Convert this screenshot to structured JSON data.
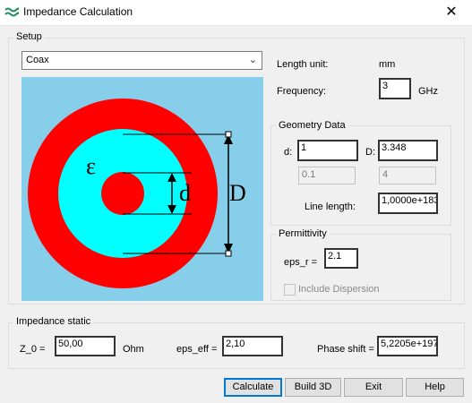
{
  "window": {
    "title": "Impedance Calculation",
    "close_glyph": "✕"
  },
  "setup": {
    "group_label": "Setup",
    "line_type": "Coax",
    "length_unit_label": "Length unit:",
    "length_unit_value": "mm",
    "frequency_label": "Frequency:",
    "frequency_value": "3",
    "frequency_unit": "GHz"
  },
  "diagram": {
    "epsilon_symbol": "ε",
    "inner_label": "d",
    "outer_label": "D",
    "colors": {
      "background": "#87ceeb",
      "conductor": "#ff0000",
      "dielectric": "#00ffff"
    }
  },
  "geometry": {
    "group_label": "Geometry Data",
    "d_label": "d:",
    "d_value": "1",
    "D_label": "D:",
    "D_value": "3.348",
    "d_secondary": "0.1",
    "D_secondary": "4",
    "line_length_label": "Line length:",
    "line_length_value": "1,0000e+183"
  },
  "permittivity": {
    "group_label": "Permittivity",
    "eps_r_label": "eps_r =",
    "eps_r_value": "2.1",
    "dispersion_label": "Include Dispersion"
  },
  "impedance": {
    "group_label": "Impedance static",
    "z0_label": "Z_0 =",
    "z0_value": "50,00",
    "z0_unit": "Ohm",
    "eps_eff_label": "eps_eff =",
    "eps_eff_value": "2,10",
    "phase_label": "Phase shift =",
    "phase_value": "5,2205e+197"
  },
  "buttons": {
    "calculate": "Calculate",
    "build3d": "Build 3D",
    "exit": "Exit",
    "help": "Help"
  }
}
